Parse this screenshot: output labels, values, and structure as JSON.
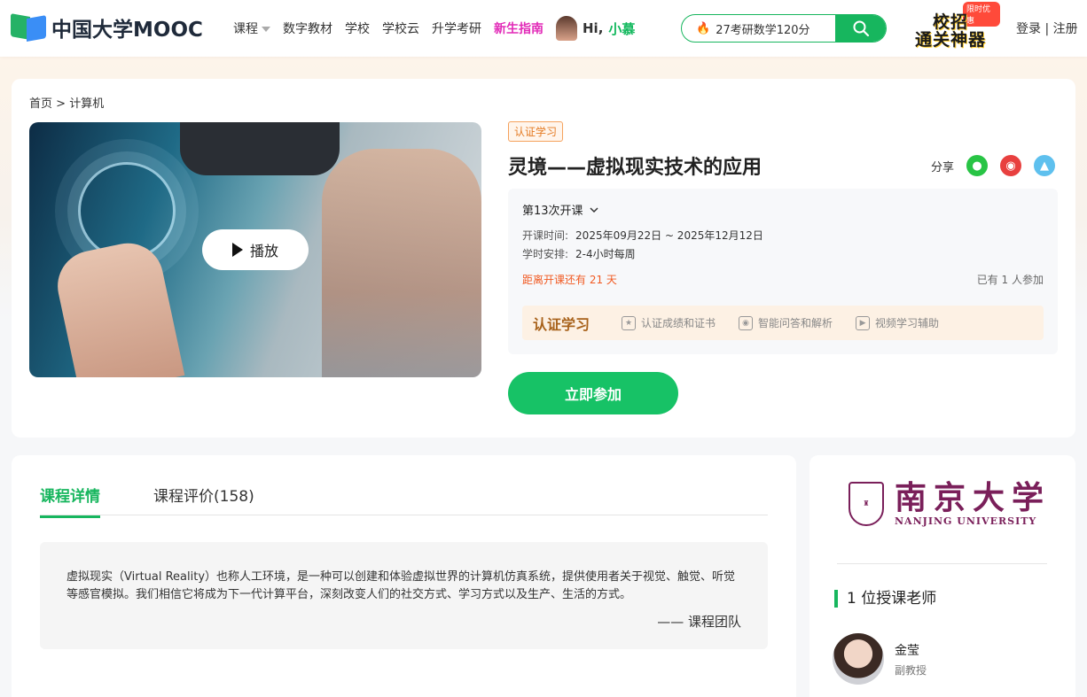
{
  "header": {
    "logo_text": "中国大学MOOC",
    "nav": [
      {
        "label": "课程"
      },
      {
        "label": "数字教材"
      },
      {
        "label": "学校"
      },
      {
        "label": "学校云"
      },
      {
        "label": "升学考研"
      },
      {
        "label": "新生指南"
      }
    ],
    "greeting_prefix": "Hi,",
    "greeting_name": "小慕",
    "search_placeholder": "27考研数学120分",
    "promo_tag": "限时优惠",
    "promo_line1": "校招",
    "promo_line2": "通关神器",
    "login": "登录",
    "divider": "|",
    "register": "注册"
  },
  "breadcrumb": {
    "home": "首页",
    "sep": ">",
    "current": "计算机"
  },
  "cover": {
    "play_label": "播放"
  },
  "course": {
    "badge": "认证学习",
    "title": "灵境——虚拟现实技术的应用",
    "share_label": "分享",
    "term": "第13次开课",
    "time_key": "开课时间:",
    "time_value": "2025年09月22日 ~ 2025年12月12日",
    "hours_key": "学时安排:",
    "hours_value": "2-4小时每周",
    "countdown": "距离开课还有 21 天",
    "joined": "已有 1 人参加",
    "cert_title": "认证学习",
    "features": [
      "认证成绩和证书",
      "智能问答和解析",
      "视频学习辅助"
    ],
    "join_button": "立即参加"
  },
  "detail": {
    "tabs": [
      "课程详情",
      "课程评价(158)"
    ],
    "intro": "虚拟现实（Virtual Reality）也称人工环境，是一种可以创建和体验虚拟世界的计算机仿真系统，提供使用者关于视觉、触觉、听觉等感官模拟。我们相信它将成为下一代计算平台，深刻改变人们的社交方式、学习方式以及生产、生活的方式。",
    "signature": "—— 课程团队"
  },
  "side": {
    "university_cn": "南京大学",
    "university_en": "NANJING UNIVERSITY",
    "teachers_heading": "1 位授课老师",
    "teacher": {
      "name": "金莹",
      "rank": "副教授"
    }
  },
  "colors": {
    "brand_green": "#17b65e",
    "accent_orange": "#f15a22",
    "uni_purple": "#7a1f5a"
  }
}
